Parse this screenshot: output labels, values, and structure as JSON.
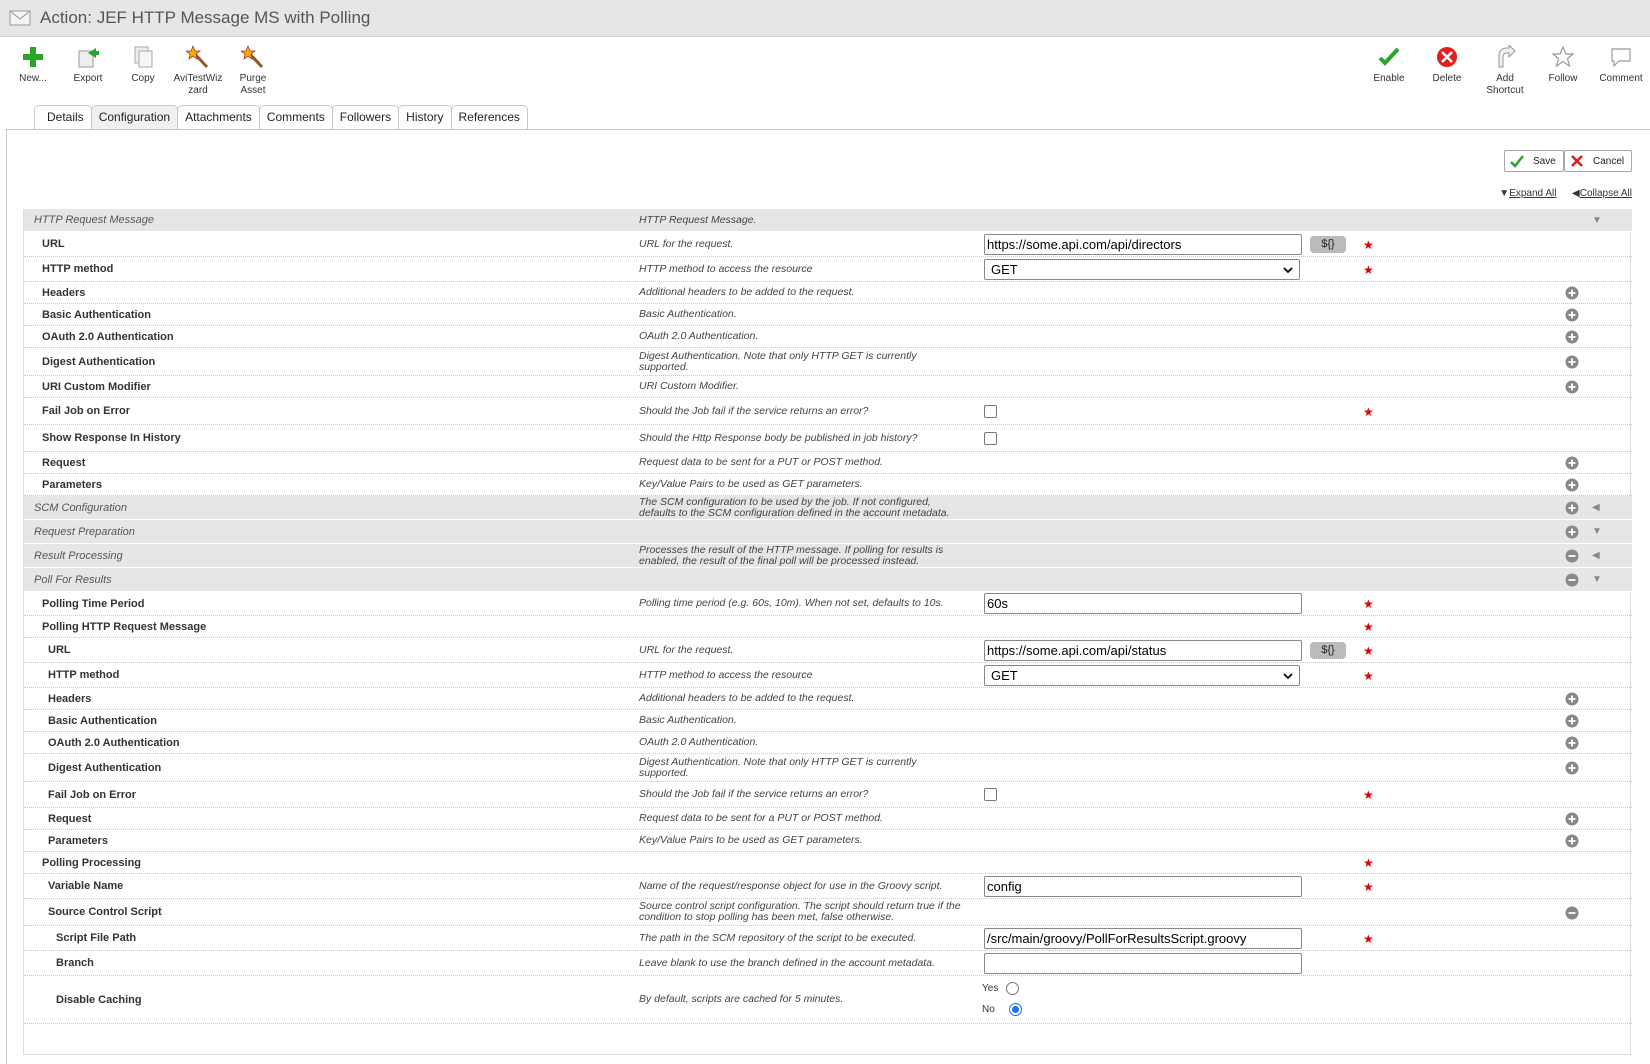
{
  "window": {
    "title": "Action: JEF HTTP Message MS with Polling"
  },
  "toolbar_left": [
    {
      "label": "New...",
      "icon": "plus-icon"
    },
    {
      "label": "Export",
      "icon": "export-icon"
    },
    {
      "label": "Copy",
      "icon": "copy-icon"
    },
    {
      "label": "AviTestWizzard",
      "line1": "AviTestWiz",
      "line2": "zard",
      "icon": "magic-wand-icon"
    },
    {
      "label": "Purge Asset",
      "line1": "Purge",
      "line2": "Asset",
      "icon": "magic-wand-icon"
    }
  ],
  "toolbar_right": [
    {
      "label": "Enable",
      "icon": "check-icon"
    },
    {
      "label": "Delete",
      "icon": "delete-icon"
    },
    {
      "label": "Add Shortcut",
      "line1": "Add",
      "line2": "Shortcut",
      "icon": "shortcut-icon"
    },
    {
      "label": "Follow",
      "icon": "star-icon"
    },
    {
      "label": "Comment",
      "icon": "comment-icon"
    }
  ],
  "tabs": [
    "Details",
    "Configuration",
    "Attachments",
    "Comments",
    "Followers",
    "History",
    "References"
  ],
  "active_tab": "Configuration",
  "actions": {
    "save": "Save",
    "cancel": "Cancel",
    "expand_all": "Expand All",
    "collapse_all": "Collapse All"
  },
  "rows": [
    {
      "label": "HTTP Request Message",
      "desc": "HTTP Request Message.",
      "group": true
    },
    {
      "label": "URL",
      "desc": "URL for the request.",
      "value": "https://some.api.com/api/directors",
      "vars": "${}",
      "required": true
    },
    {
      "label": "HTTP method",
      "desc": "HTTP method to access the resource",
      "select": "GET",
      "required": true
    },
    {
      "label": "Headers",
      "desc": "Additional headers to be added to the request."
    },
    {
      "label": "Basic Authentication",
      "desc": "Basic Authentication."
    },
    {
      "label": "OAuth 2.0 Authentication",
      "desc": "OAuth 2.0 Authentication."
    },
    {
      "label": "Digest Authentication",
      "desc": "Digest Authentication. Note that only HTTP GET is currently supported."
    },
    {
      "label": "URI Custom Modifier",
      "desc": "URI Custom Modifier."
    },
    {
      "label": "Fail Job on Error",
      "desc": "Should the Job fail if the service returns an error?",
      "checked": false,
      "required": true
    },
    {
      "label": "Show Response In History",
      "desc": "Should the Http Response body be published in job history?",
      "checked": false
    },
    {
      "label": "Request",
      "desc": "Request data to be sent for a PUT or POST method."
    },
    {
      "label": "Parameters",
      "desc": "Key/Value Pairs to be used as GET parameters."
    },
    {
      "label": "SCM Configuration",
      "desc": "The SCM configuration to be used by the job. If not configured, defaults to the SCM configuration defined in the account metadata.",
      "group": true
    },
    {
      "label": "Request Preparation",
      "desc": "",
      "group": true
    },
    {
      "label": "Result Processing",
      "desc": "Processes the result of the HTTP message. If polling for results is enabled, the result of the final poll will be processed instead.",
      "group": true
    },
    {
      "label": "Poll For Results",
      "desc": "",
      "group": true
    },
    {
      "label": "Polling Time Period",
      "desc": "Polling time period (e.g. 60s, 10m). When not set, defaults to 10s.",
      "value": "60s",
      "required": true
    },
    {
      "label": "Polling HTTP Request Message",
      "desc": "",
      "required": true
    },
    {
      "label": "URL",
      "desc": "URL for the request.",
      "value": "https://some.api.com/api/status",
      "vars": "${}",
      "required": true
    },
    {
      "label": "HTTP method",
      "desc": "HTTP method to access the resource",
      "select": "GET",
      "required": true
    },
    {
      "label": "Headers",
      "desc": "Additional headers to be added to the request."
    },
    {
      "label": "Basic Authentication",
      "desc": "Basic Authentication."
    },
    {
      "label": "OAuth 2.0 Authentication",
      "desc": "OAuth 2.0 Authentication."
    },
    {
      "label": "Digest Authentication",
      "desc": "Digest Authentication. Note that only HTTP GET is currently supported."
    },
    {
      "label": "Fail Job on Error",
      "desc": "Should the Job fail if the service returns an error?",
      "checked": false,
      "required": true
    },
    {
      "label": "Request",
      "desc": "Request data to be sent for a PUT or POST method."
    },
    {
      "label": "Parameters",
      "desc": "Key/Value Pairs to be used as GET parameters."
    },
    {
      "label": "Polling Processing",
      "desc": "",
      "required": true
    },
    {
      "label": "Variable Name",
      "desc": "Name of the request/response object for use in the Groovy script.",
      "value": "config",
      "required": true
    },
    {
      "label": "Source Control Script",
      "desc": "Source control script configuration. The script should return true if the condition to stop polling has been met, false otherwise."
    },
    {
      "label": "Script File Path",
      "desc": "The path in the SCM repository of the script to be executed.",
      "value": "/src/main/groovy/PollForResultsScript.groovy",
      "required": true
    },
    {
      "label": "Branch",
      "desc": "Leave blank to use the branch defined in the account metadata.",
      "value": ""
    },
    {
      "label": "Disable Caching",
      "desc": "By default, scripts are cached for 5 minutes.",
      "radio_yes": "Yes",
      "radio_no": "No",
      "selected": "No"
    }
  ]
}
